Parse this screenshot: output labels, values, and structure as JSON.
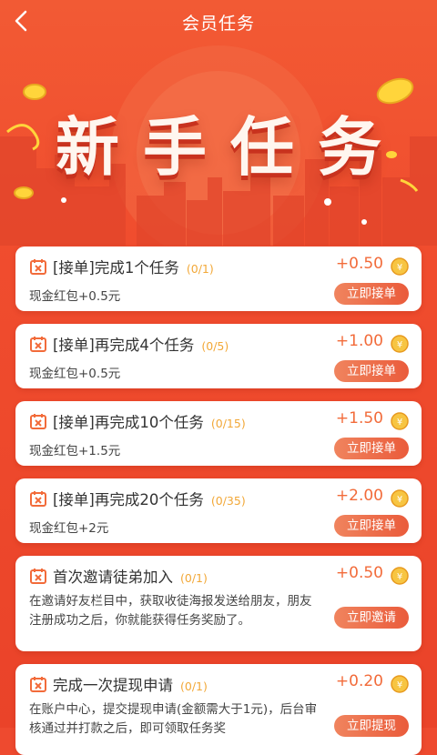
{
  "header": {
    "title": "会员任务"
  },
  "banner": {
    "title": "新手任务"
  },
  "tasks": [
    {
      "title": "[接单]完成1个任务",
      "progress": "(0/1)",
      "reward": "+0.50",
      "desc": "现金红包+0.5元",
      "button": "立即接单"
    },
    {
      "title": "[接单]再完成4个任务",
      "progress": "(0/5)",
      "reward": "+1.00",
      "desc": "现金红包+0.5元",
      "button": "立即接单"
    },
    {
      "title": "[接单]再完成10个任务",
      "progress": "(0/15)",
      "reward": "+1.50",
      "desc": "现金红包+1.5元",
      "button": "立即接单"
    },
    {
      "title": "[接单]再完成20个任务",
      "progress": "(0/35)",
      "reward": "+2.00",
      "desc": "现金红包+2元",
      "button": "立即接单"
    },
    {
      "title": "首次邀请徒弟加入",
      "progress": "(0/1)",
      "reward": "+0.50",
      "desc": "在邀请好友栏目中，获取收徒海报发送给朋友，朋友注册成功之后，你就能获得任务奖励了。",
      "button": "立即邀请"
    },
    {
      "title": "完成一次提现申请",
      "progress": "(0/1)",
      "reward": "+0.20",
      "desc": "在账户中心，提交提现申请(金额需大于1元)，后台审核通过并打款之后，即可领取任务奖",
      "button": "立即提现"
    }
  ],
  "colors": {
    "accent": "#f26b3a",
    "progress": "#f2a838",
    "background": "#ee4a2f"
  }
}
